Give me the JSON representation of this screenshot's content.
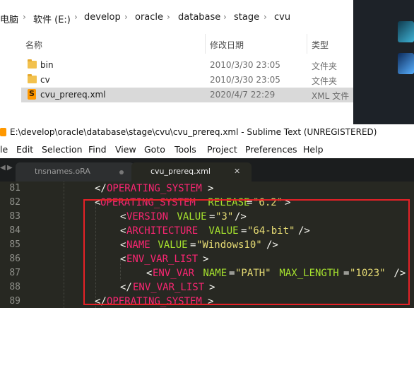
{
  "explorer": {
    "breadcrumb": {
      "root": "电脑",
      "drive": "软件 (E:)",
      "p1": "develop",
      "p2": "oracle",
      "p3": "database",
      "p4": "stage",
      "p5": "cvu",
      "separator": "›"
    },
    "columns": {
      "name": "名称",
      "modified": "修改日期",
      "type": "类型"
    },
    "files": [
      {
        "name": "bin",
        "modified": "2010/3/30 23:05",
        "type": "文件夹",
        "icon": "folder-icon"
      },
      {
        "name": "cv",
        "modified": "2010/3/30 23:05",
        "type": "文件夹",
        "icon": "folder-icon"
      },
      {
        "name": "cvu_prereq.xml",
        "modified": "2020/4/7 22:29",
        "type": "XML 文件",
        "icon": "sublime-file-icon",
        "selected": true
      }
    ]
  },
  "sublime": {
    "title": "E:\\develop\\oracle\\database\\stage\\cvu\\cvu_prereq.xml - Sublime Text (UNREGISTERED)",
    "menu": [
      "le",
      "Edit",
      "Selection",
      "Find",
      "View",
      "Goto",
      "Tools",
      "Project",
      "Preferences",
      "Help"
    ],
    "tabs": [
      {
        "label": "tnsnames.oRA",
        "active": false
      },
      {
        "label": "cvu_prereq.xml",
        "active": true
      }
    ],
    "lines": [
      {
        "num": "81",
        "t1": "</",
        "t2": "OPERATING_SYSTEM",
        "t3": ">"
      },
      {
        "num": "82",
        "t1": "<",
        "t2": "OPERATING_SYSTEM",
        "t3": " RELEASE",
        "t4": "=",
        "t5": "\"6.2\"",
        "t6": ">"
      },
      {
        "num": "83",
        "t1": "<",
        "t2": "VERSION",
        "t3": " VALUE",
        "t4": "=",
        "t5": "\"3\"",
        "t6": "/>"
      },
      {
        "num": "84",
        "t1": "<",
        "t2": "ARCHITECTURE",
        "t3": " VALUE",
        "t4": "=",
        "t5": "\"64-bit\"",
        "t6": "/>"
      },
      {
        "num": "85",
        "t1": "<",
        "t2": "NAME",
        "t3": " VALUE",
        "t4": "=",
        "t5": "\"Windows10\"",
        "t6": "/>"
      },
      {
        "num": "86",
        "t1": "<",
        "t2": "ENV_VAR_LIST",
        "t3": ">"
      },
      {
        "num": "87",
        "t1": "<",
        "t2": "ENV_VAR",
        "t3": " NAME",
        "t4": "=",
        "t5": "\"PATH\"",
        "t6": " MAX_LENGTH",
        "t7": "=",
        "t8": "\"1023\"",
        "t9": " />"
      },
      {
        "num": "88",
        "t1": "</",
        "t2": "ENV_VAR_LIST",
        "t3": ">"
      },
      {
        "num": "89",
        "t1": "</",
        "t2": "OPERATING_SYSTEM",
        "t3": ">"
      }
    ]
  },
  "colors": {
    "highlight_border": "#e52127",
    "editor_bg": "#272822",
    "tag": "#f92672",
    "attr": "#a6e22e",
    "string": "#e6db74"
  }
}
